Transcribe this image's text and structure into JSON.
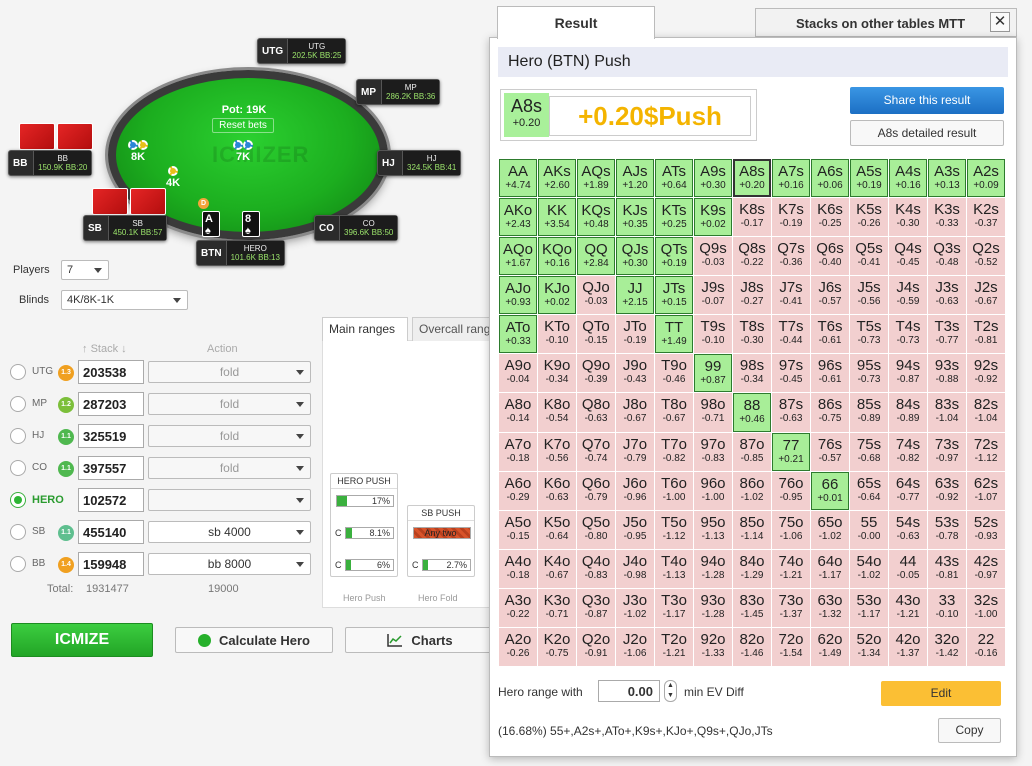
{
  "table": {
    "watermark": "ICMIZER",
    "pot": "Pot: 19K",
    "reset_bets": "Reset bets",
    "bets": [
      "8K",
      "7K",
      "4K"
    ],
    "dealer": "D",
    "seats": [
      {
        "pos": "UTG",
        "name": "UTG",
        "stack": "202.5K BB:25"
      },
      {
        "pos": "MP",
        "name": "MP",
        "stack": "286.2K BB:36"
      },
      {
        "pos": "HJ",
        "name": "HJ",
        "stack": "324.5K BB:41"
      },
      {
        "pos": "CO",
        "name": "CO",
        "stack": "396.6K BB:50"
      },
      {
        "pos": "BTN",
        "name": "HERO",
        "stack": "101.6K BB:13"
      },
      {
        "pos": "SB",
        "name": "SB",
        "stack": "450.1K BB:57"
      },
      {
        "pos": "BB",
        "name": "BB",
        "stack": "150.9K BB:20"
      }
    ],
    "hero_cards": [
      "A",
      "8"
    ]
  },
  "settings": {
    "players_label": "Players",
    "players_value": "7",
    "blinds_label": "Blinds",
    "blinds_value": "4K/8K-1K"
  },
  "players_table": {
    "stack_header": "Stack",
    "action_header": "Action",
    "rows": [
      {
        "name": "UTG",
        "badge": "1.3",
        "badge_color": "#f0a020",
        "stack": "203538",
        "action": "fold",
        "selected": false
      },
      {
        "name": "MP",
        "badge": "1.2",
        "badge_color": "#7cbf3a",
        "stack": "287203",
        "action": "fold",
        "selected": false
      },
      {
        "name": "HJ",
        "badge": "1.1",
        "badge_color": "#4fb84f",
        "stack": "325519",
        "action": "fold",
        "selected": false
      },
      {
        "name": "CO",
        "badge": "1.1",
        "badge_color": "#4fb84f",
        "stack": "397557",
        "action": "fold",
        "selected": false
      },
      {
        "name": "HERO",
        "badge": "",
        "badge_color": "",
        "stack": "102572",
        "action": "",
        "selected": true
      },
      {
        "name": "SB",
        "badge": "1.1",
        "badge_color": "#5fbf8f",
        "stack": "455140",
        "action": "sb 4000",
        "selected": false
      },
      {
        "name": "BB",
        "badge": "1.4",
        "badge_color": "#f0a020",
        "stack": "159948",
        "action": "bb 8000",
        "selected": false
      }
    ],
    "total_label": "Total:",
    "total_stack": "1931477",
    "total_action": "19000"
  },
  "ranges": {
    "tab_main": "Main ranges",
    "tab_overcall": "Overcall ranges",
    "hero_push": {
      "title": "HERO PUSH",
      "bars": [
        {
          "label": "",
          "value": "17%",
          "fill": 0.17
        },
        {
          "label": "C",
          "value": "8.1%",
          "fill": 0.081
        },
        {
          "label": "C",
          "value": "6%",
          "fill": 0.06
        }
      ],
      "footer": "Hero Push"
    },
    "sb_push": {
      "title": "SB PUSH",
      "any_two": "Any two",
      "bars": [
        {
          "label": "C",
          "value": "2.7%",
          "fill": 0.027
        }
      ],
      "footer": "Hero Fold"
    }
  },
  "buttons": {
    "icmize": "ICMIZE",
    "calculate_hero": "Calculate Hero",
    "charts": "Charts"
  },
  "result": {
    "tab_result": "Result",
    "tab_stacks": "Stacks on other tables MTT",
    "title": "Hero (BTN) Push",
    "hand": "A8s",
    "hand_ev": "+0.20",
    "hand_result": "+0.20$Push",
    "share_label": "Share this result",
    "detail_label": "A8s detailed result",
    "selected_hand": "A8s",
    "grid": [
      [
        [
          "AA",
          "+4.74"
        ],
        [
          "AKs",
          "+2.60"
        ],
        [
          "AQs",
          "+1.89"
        ],
        [
          "AJs",
          "+1.20"
        ],
        [
          "ATs",
          "+0.64"
        ],
        [
          "A9s",
          "+0.30"
        ],
        [
          "A8s",
          "+0.20"
        ],
        [
          "A7s",
          "+0.16"
        ],
        [
          "A6s",
          "+0.06"
        ],
        [
          "A5s",
          "+0.19"
        ],
        [
          "A4s",
          "+0.16"
        ],
        [
          "A3s",
          "+0.13"
        ],
        [
          "A2s",
          "+0.09"
        ]
      ],
      [
        [
          "AKo",
          "+2.43"
        ],
        [
          "KK",
          "+3.54"
        ],
        [
          "KQs",
          "+0.48"
        ],
        [
          "KJs",
          "+0.35"
        ],
        [
          "KTs",
          "+0.25"
        ],
        [
          "K9s",
          "+0.02"
        ],
        [
          "K8s",
          "-0.17"
        ],
        [
          "K7s",
          "-0.19"
        ],
        [
          "K6s",
          "-0.25"
        ],
        [
          "K5s",
          "-0.26"
        ],
        [
          "K4s",
          "-0.30"
        ],
        [
          "K3s",
          "-0.33"
        ],
        [
          "K2s",
          "-0.37"
        ]
      ],
      [
        [
          "AQo",
          "+1.67"
        ],
        [
          "KQo",
          "+0.16"
        ],
        [
          "QQ",
          "+2.84"
        ],
        [
          "QJs",
          "+0.30"
        ],
        [
          "QTs",
          "+0.19"
        ],
        [
          "Q9s",
          "-0.03"
        ],
        [
          "Q8s",
          "-0.22"
        ],
        [
          "Q7s",
          "-0.36"
        ],
        [
          "Q6s",
          "-0.40"
        ],
        [
          "Q5s",
          "-0.41"
        ],
        [
          "Q4s",
          "-0.45"
        ],
        [
          "Q3s",
          "-0.48"
        ],
        [
          "Q2s",
          "-0.52"
        ]
      ],
      [
        [
          "AJo",
          "+0.93"
        ],
        [
          "KJo",
          "+0.02"
        ],
        [
          "QJo",
          "-0.03"
        ],
        [
          "JJ",
          "+2.15"
        ],
        [
          "JTs",
          "+0.15"
        ],
        [
          "J9s",
          "-0.07"
        ],
        [
          "J8s",
          "-0.27"
        ],
        [
          "J7s",
          "-0.41"
        ],
        [
          "J6s",
          "-0.57"
        ],
        [
          "J5s",
          "-0.56"
        ],
        [
          "J4s",
          "-0.59"
        ],
        [
          "J3s",
          "-0.63"
        ],
        [
          "J2s",
          "-0.67"
        ]
      ],
      [
        [
          "ATo",
          "+0.33"
        ],
        [
          "KTo",
          "-0.10"
        ],
        [
          "QTo",
          "-0.15"
        ],
        [
          "JTo",
          "-0.19"
        ],
        [
          "TT",
          "+1.49"
        ],
        [
          "T9s",
          "-0.10"
        ],
        [
          "T8s",
          "-0.30"
        ],
        [
          "T7s",
          "-0.44"
        ],
        [
          "T6s",
          "-0.61"
        ],
        [
          "T5s",
          "-0.73"
        ],
        [
          "T4s",
          "-0.73"
        ],
        [
          "T3s",
          "-0.77"
        ],
        [
          "T2s",
          "-0.81"
        ]
      ],
      [
        [
          "A9o",
          "-0.04"
        ],
        [
          "K9o",
          "-0.34"
        ],
        [
          "Q9o",
          "-0.39"
        ],
        [
          "J9o",
          "-0.43"
        ],
        [
          "T9o",
          "-0.46"
        ],
        [
          "99",
          "+0.87"
        ],
        [
          "98s",
          "-0.34"
        ],
        [
          "97s",
          "-0.45"
        ],
        [
          "96s",
          "-0.61"
        ],
        [
          "95s",
          "-0.73"
        ],
        [
          "94s",
          "-0.87"
        ],
        [
          "93s",
          "-0.88"
        ],
        [
          "92s",
          "-0.92"
        ]
      ],
      [
        [
          "A8o",
          "-0.14"
        ],
        [
          "K8o",
          "-0.54"
        ],
        [
          "Q8o",
          "-0.63"
        ],
        [
          "J8o",
          "-0.67"
        ],
        [
          "T8o",
          "-0.67"
        ],
        [
          "98o",
          "-0.71"
        ],
        [
          "88",
          "+0.46"
        ],
        [
          "87s",
          "-0.63"
        ],
        [
          "86s",
          "-0.75"
        ],
        [
          "85s",
          "-0.89"
        ],
        [
          "84s",
          "-0.89"
        ],
        [
          "83s",
          "-1.04"
        ],
        [
          "82s",
          "-1.04"
        ]
      ],
      [
        [
          "A7o",
          "-0.18"
        ],
        [
          "K7o",
          "-0.56"
        ],
        [
          "Q7o",
          "-0.74"
        ],
        [
          "J7o",
          "-0.79"
        ],
        [
          "T7o",
          "-0.82"
        ],
        [
          "97o",
          "-0.83"
        ],
        [
          "87o",
          "-0.85"
        ],
        [
          "77",
          "+0.21"
        ],
        [
          "76s",
          "-0.57"
        ],
        [
          "75s",
          "-0.68"
        ],
        [
          "74s",
          "-0.82"
        ],
        [
          "73s",
          "-0.97"
        ],
        [
          "72s",
          "-1.12"
        ]
      ],
      [
        [
          "A6o",
          "-0.29"
        ],
        [
          "K6o",
          "-0.63"
        ],
        [
          "Q6o",
          "-0.79"
        ],
        [
          "J6o",
          "-0.96"
        ],
        [
          "T6o",
          "-1.00"
        ],
        [
          "96o",
          "-1.00"
        ],
        [
          "86o",
          "-1.02"
        ],
        [
          "76o",
          "-0.95"
        ],
        [
          "66",
          "+0.01"
        ],
        [
          "65s",
          "-0.64"
        ],
        [
          "64s",
          "-0.77"
        ],
        [
          "63s",
          "-0.92"
        ],
        [
          "62s",
          "-1.07"
        ]
      ],
      [
        [
          "A5o",
          "-0.15"
        ],
        [
          "K5o",
          "-0.64"
        ],
        [
          "Q5o",
          "-0.80"
        ],
        [
          "J5o",
          "-0.95"
        ],
        [
          "T5o",
          "-1.12"
        ],
        [
          "95o",
          "-1.13"
        ],
        [
          "85o",
          "-1.14"
        ],
        [
          "75o",
          "-1.06"
        ],
        [
          "65o",
          "-1.02"
        ],
        [
          "55",
          "-0.00"
        ],
        [
          "54s",
          "-0.63"
        ],
        [
          "53s",
          "-0.78"
        ],
        [
          "52s",
          "-0.93"
        ]
      ],
      [
        [
          "A4o",
          "-0.18"
        ],
        [
          "K4o",
          "-0.67"
        ],
        [
          "Q4o",
          "-0.83"
        ],
        [
          "J4o",
          "-0.98"
        ],
        [
          "T4o",
          "-1.13"
        ],
        [
          "94o",
          "-1.28"
        ],
        [
          "84o",
          "-1.29"
        ],
        [
          "74o",
          "-1.21"
        ],
        [
          "64o",
          "-1.17"
        ],
        [
          "54o",
          "-1.02"
        ],
        [
          "44",
          "-0.05"
        ],
        [
          "43s",
          "-0.81"
        ],
        [
          "42s",
          "-0.97"
        ]
      ],
      [
        [
          "A3o",
          "-0.22"
        ],
        [
          "K3o",
          "-0.71"
        ],
        [
          "Q3o",
          "-0.87"
        ],
        [
          "J3o",
          "-1.02"
        ],
        [
          "T3o",
          "-1.17"
        ],
        [
          "93o",
          "-1.28"
        ],
        [
          "83o",
          "-1.45"
        ],
        [
          "73o",
          "-1.37"
        ],
        [
          "63o",
          "-1.32"
        ],
        [
          "53o",
          "-1.17"
        ],
        [
          "43o",
          "-1.21"
        ],
        [
          "33",
          "-0.10"
        ],
        [
          "32s",
          "-1.00"
        ]
      ],
      [
        [
          "A2o",
          "-0.26"
        ],
        [
          "K2o",
          "-0.75"
        ],
        [
          "Q2o",
          "-0.91"
        ],
        [
          "J2o",
          "-1.06"
        ],
        [
          "T2o",
          "-1.21"
        ],
        [
          "92o",
          "-1.33"
        ],
        [
          "82o",
          "-1.46"
        ],
        [
          "72o",
          "-1.54"
        ],
        [
          "62o",
          "-1.49"
        ],
        [
          "52o",
          "-1.34"
        ],
        [
          "42o",
          "-1.37"
        ],
        [
          "32o",
          "-1.42"
        ],
        [
          "22",
          "-0.16"
        ]
      ]
    ],
    "range_with_label": "Hero range with",
    "min_ev_value": "0.00",
    "min_ev_label": "min EV Diff",
    "edit_label": "Edit",
    "range_text": "(16.68%) 55+,A2s+,ATo+,K9s+,KJo+,Q9s+,QJo,JTs",
    "copy_label": "Copy"
  },
  "colors": {
    "push": "#a8ee98",
    "fold": "#f2cfcf",
    "accent": "#2db534",
    "share": "#1c6fc4",
    "edit": "#fbbf34"
  }
}
